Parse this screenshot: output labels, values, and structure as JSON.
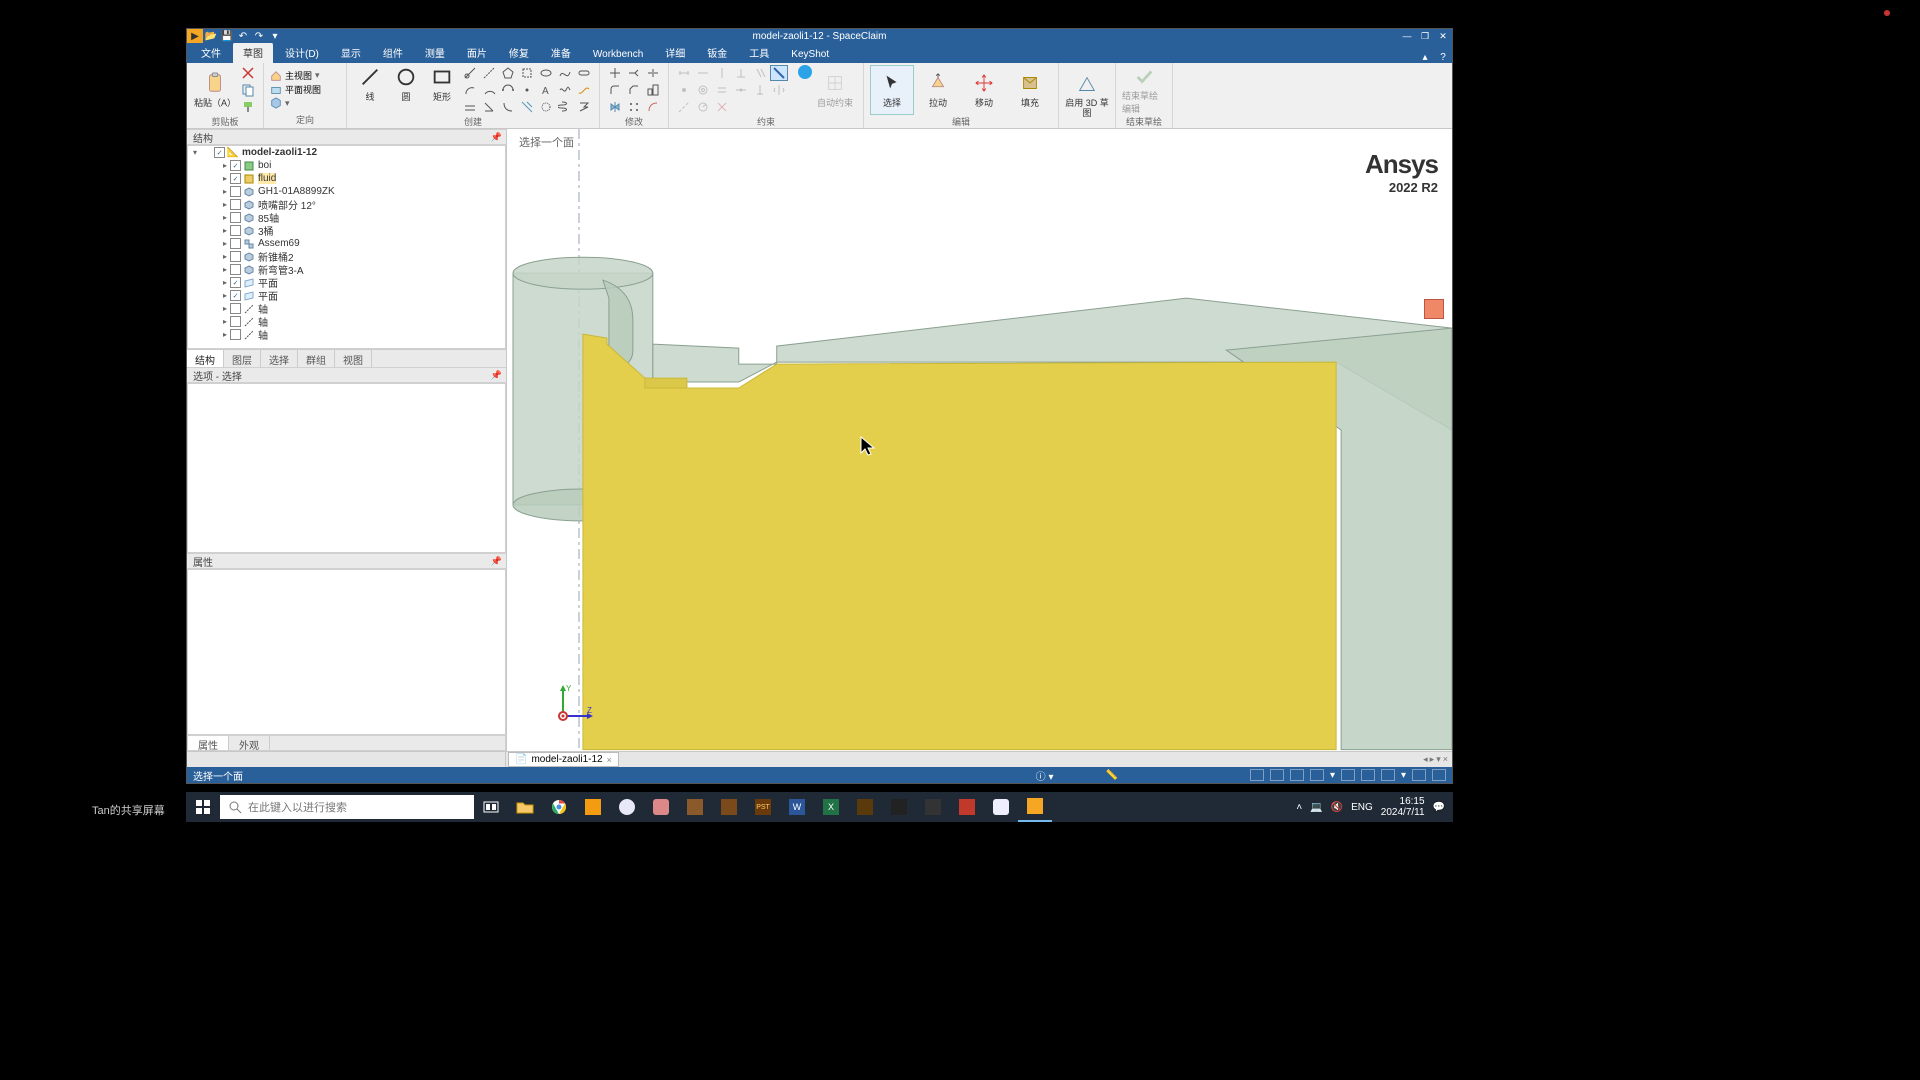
{
  "window": {
    "title": "model-zaoli1-12 - SpaceClaim",
    "minimize": "—",
    "maximize": "❐",
    "close": "✕"
  },
  "qat": {
    "play": "▶",
    "open": "📂",
    "save": "💾",
    "undo": "↶",
    "redo": "↷",
    "more": "▾"
  },
  "ribbon_tabs": [
    "文件",
    "草图",
    "设计(D)",
    "显示",
    "组件",
    "测量",
    "面片",
    "修复",
    "准备",
    "Workbench",
    "详细",
    "钣金",
    "工具",
    "KeyShot"
  ],
  "ribbon_tabs_active": 1,
  "ribbon_help": {
    "up": "▴",
    "q": "?"
  },
  "ribbon": {
    "clipboard": {
      "paste": "粘贴（A）",
      "label": "剪贴板"
    },
    "orient": {
      "home": "主视图",
      "plan": "平面视图",
      "label": "定向"
    },
    "create": {
      "line": "线",
      "circle": "圆",
      "rect": "矩形",
      "label": "创建"
    },
    "modify": {
      "label": "修改"
    },
    "constrain": {
      "auto": "自动约束",
      "label": "约束"
    },
    "edit": {
      "select": "选择",
      "pull": "拉动",
      "move": "移动",
      "fill": "填充",
      "label": "编辑"
    },
    "mode": {
      "start3d": "启用 3D 草图",
      "label": ""
    },
    "end": {
      "finish": "结束草绘编辑",
      "label": "结束草绘"
    }
  },
  "panels": {
    "structure": "结构",
    "options": "选项 - 选择",
    "properties": "属性"
  },
  "tree": {
    "root": "model-zaoli1-12",
    "items": [
      {
        "label": "boi",
        "indent": 2,
        "chk": true,
        "ic": "cube-g"
      },
      {
        "label": "fluid",
        "indent": 2,
        "chk": true,
        "ic": "cube-y",
        "sel": true
      },
      {
        "label": "GH1-01A8899ZK",
        "indent": 2,
        "chk": false,
        "ic": "part"
      },
      {
        "label": "喷嘴部分 12°",
        "indent": 2,
        "chk": false,
        "ic": "part"
      },
      {
        "label": "85轴",
        "indent": 2,
        "chk": false,
        "ic": "part"
      },
      {
        "label": "3桶",
        "indent": 2,
        "chk": false,
        "ic": "part"
      },
      {
        "label": "Assem69",
        "indent": 2,
        "chk": false,
        "ic": "asm"
      },
      {
        "label": "新锥桶2",
        "indent": 2,
        "chk": false,
        "ic": "part"
      },
      {
        "label": "新弯管3-A",
        "indent": 2,
        "chk": false,
        "ic": "part"
      },
      {
        "label": "平面",
        "indent": 2,
        "chk": true,
        "ic": "plane"
      },
      {
        "label": "平面",
        "indent": 2,
        "chk": true,
        "ic": "plane"
      },
      {
        "label": "轴",
        "indent": 2,
        "chk": false,
        "ic": "axis"
      },
      {
        "label": "轴",
        "indent": 2,
        "chk": false,
        "ic": "axis"
      },
      {
        "label": "轴",
        "indent": 2,
        "chk": false,
        "ic": "axis"
      }
    ]
  },
  "tree_tabs": [
    "结构",
    "图层",
    "选择",
    "群组",
    "视图"
  ],
  "tree_tabs_active": 0,
  "prop_tabs": [
    "属性",
    "外观"
  ],
  "prop_tabs_active": 0,
  "viewport": {
    "hint": "选择一个面",
    "brand": "Ansys",
    "version": "2022 R2",
    "axes": {
      "y": "Y",
      "z": "Z"
    }
  },
  "doc_tab": {
    "name": "model-zaoli1-12",
    "close": "×"
  },
  "app_status": {
    "left": "选择一个面",
    "info": "ⓘ ▾",
    "measure": "📏"
  },
  "taskbar": {
    "search_placeholder": "在此键入以进行搜索",
    "lang": "ENG",
    "time": "16:15",
    "date": "2024/7/11"
  },
  "share_label": "Tan的共享屏幕"
}
